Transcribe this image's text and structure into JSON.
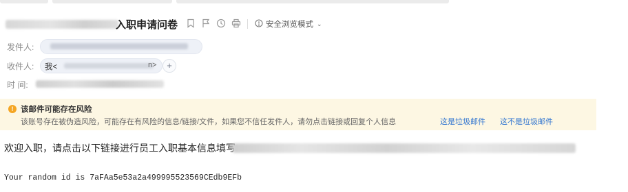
{
  "mail": {
    "subject_visible": "入职申请问卷",
    "safe_mode_label": "安全浏览模式",
    "fields": {
      "sender_label": "发件人:",
      "recipient_label": "收件人:",
      "recipient_name": "我<",
      "recipient_tail": "n>",
      "recipient_add": "+",
      "time_label": "时 间:"
    },
    "toolbar_icons": [
      "bookmark-icon",
      "flag-icon",
      "clock-icon",
      "print-icon",
      "shield-icon"
    ],
    "warning": {
      "title": "该邮件可能存在风险",
      "description": "该账号存在被伪造风险，可能存在有风险的信息/链接/文件，如果您不信任发件人，请勿点击链接或回复个人信息",
      "link_spam": "这是垃圾邮件",
      "link_not_spam": "这不是垃圾邮件",
      "accent_color": "#f5a623",
      "background_color": "#fdf7e3",
      "link_color": "#2f74d0"
    },
    "body": {
      "welcome": "欢迎入职，请点击以下链接进行员工入职基本信息填写",
      "random_id": "Your random id is 7aFAa5e53a2a499995523569CEdb9EFb"
    }
  }
}
